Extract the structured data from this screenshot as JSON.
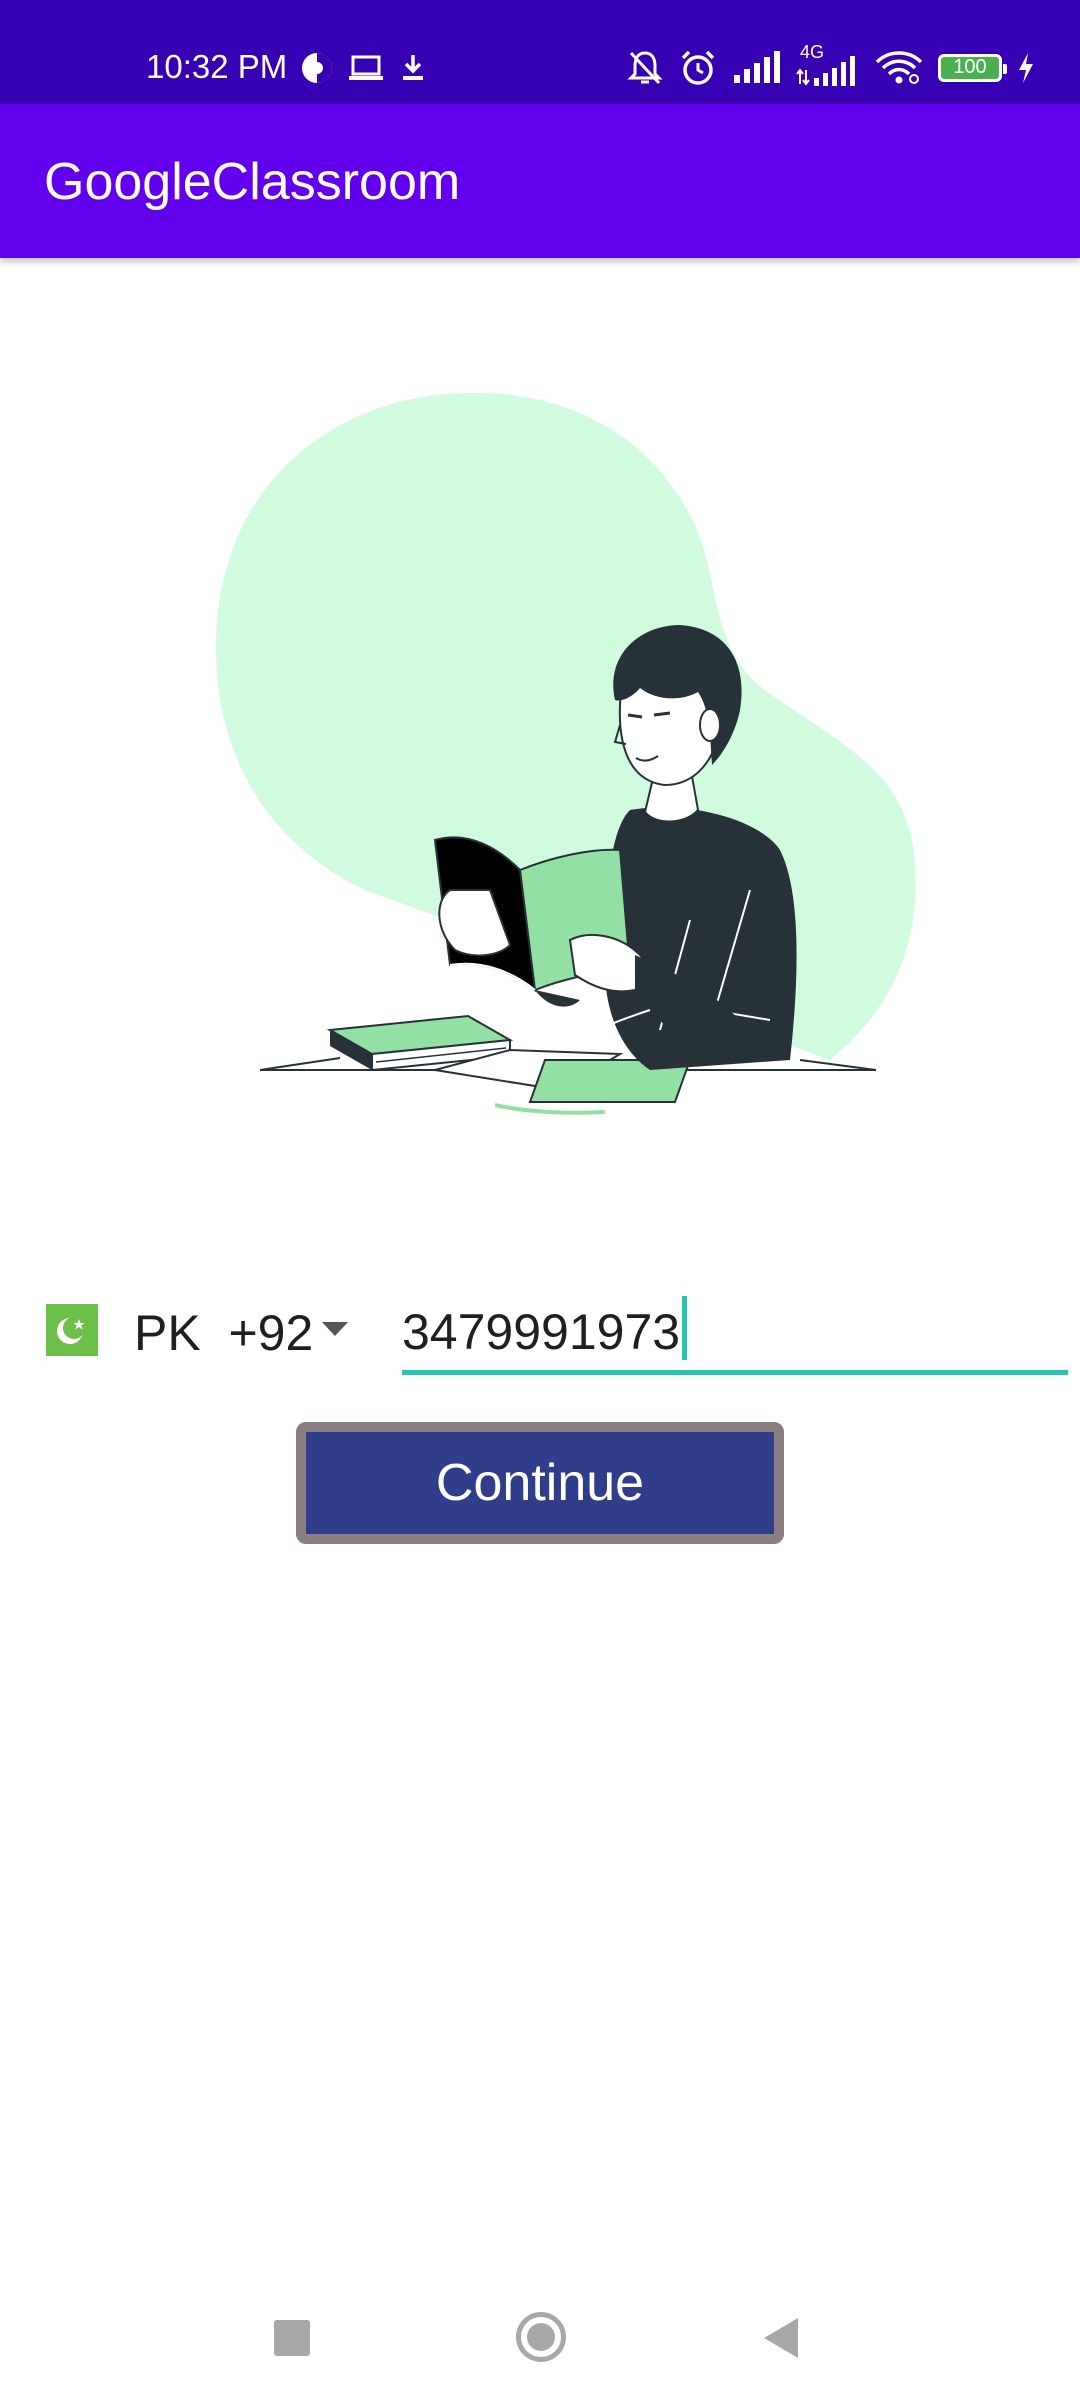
{
  "status_bar": {
    "time": "10:32 PM",
    "network_label": "4G",
    "battery_level": "100",
    "icons": [
      "data-saver-icon",
      "laptop-icon",
      "download-icon",
      "silent-bell-icon",
      "alarm-icon",
      "signal-icon",
      "4g-signal-icon",
      "wifi-icon",
      "battery-icon",
      "charging-icon"
    ]
  },
  "app_bar": {
    "title": "GoogleClassroom"
  },
  "illustration": {
    "icon": "person-reading-book-illustration",
    "colors": {
      "blob": "#d0fbdf",
      "accent_green": "#93e0a4",
      "dark": "#263238"
    }
  },
  "phone_form": {
    "flag_icon": "pakistan-flag-icon",
    "country_code": "PK  +92",
    "phone_number": "3479991973",
    "accent_color": "#23c6b0"
  },
  "continue_button": {
    "label": "Continue",
    "background": "#303d8a",
    "border": "#8a7f80"
  },
  "nav_bar": {
    "icons": [
      "recents-icon",
      "home-icon",
      "back-icon"
    ]
  },
  "colors": {
    "status_bar": "#3700B3",
    "app_bar": "#6200EE"
  }
}
